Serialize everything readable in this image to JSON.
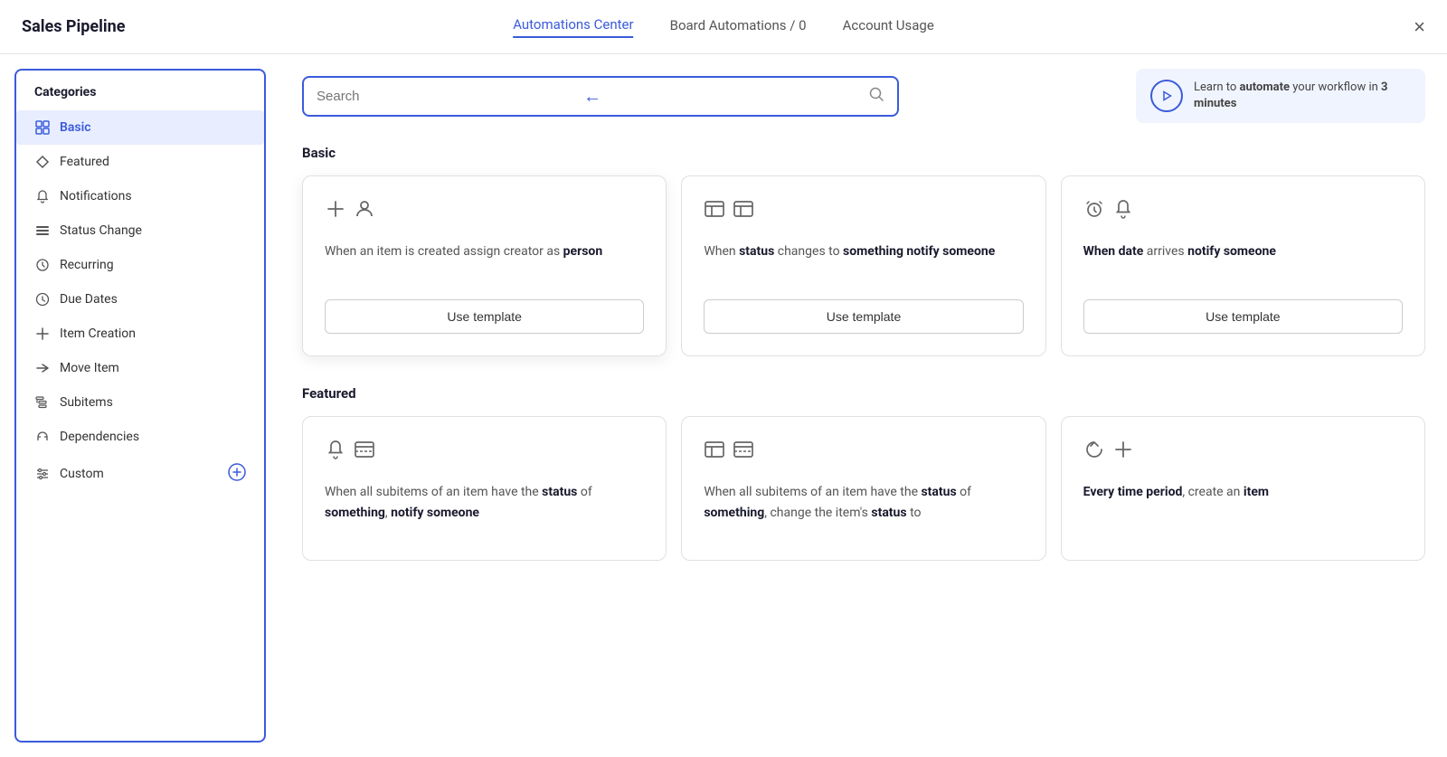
{
  "header": {
    "title": "Sales Pipeline",
    "tabs": [
      {
        "label": "Automations Center",
        "active": true
      },
      {
        "label": "Board Automations / 0",
        "active": false
      },
      {
        "label": "Account Usage",
        "active": false
      }
    ],
    "close_label": "×"
  },
  "sidebar": {
    "title": "Categories",
    "items": [
      {
        "id": "basic",
        "label": "Basic",
        "icon": "grid",
        "active": true
      },
      {
        "id": "featured",
        "label": "Featured",
        "icon": "diamond",
        "active": false
      },
      {
        "id": "notifications",
        "label": "Notifications",
        "icon": "bell",
        "active": false
      },
      {
        "id": "status-change",
        "label": "Status Change",
        "icon": "list",
        "active": false
      },
      {
        "id": "recurring",
        "label": "Recurring",
        "icon": "recurring",
        "active": false
      },
      {
        "id": "due-dates",
        "label": "Due Dates",
        "icon": "clock",
        "active": false
      },
      {
        "id": "item-creation",
        "label": "Item Creation",
        "icon": "plus",
        "active": false
      },
      {
        "id": "move-item",
        "label": "Move Item",
        "icon": "arrow-right",
        "active": false
      },
      {
        "id": "subitems",
        "label": "Subitems",
        "icon": "subitems",
        "active": false
      },
      {
        "id": "dependencies",
        "label": "Dependencies",
        "icon": "dependencies",
        "active": false
      },
      {
        "id": "custom",
        "label": "Custom",
        "icon": "sliders",
        "active": false,
        "has_add": true
      }
    ]
  },
  "search": {
    "placeholder": "Search",
    "has_arrow": true
  },
  "learn_banner": {
    "text_before": "Learn to ",
    "text_bold1": "automate",
    "text_middle": " your workflow in ",
    "text_bold2": "3 minutes"
  },
  "sections": [
    {
      "id": "basic",
      "title": "Basic",
      "cards": [
        {
          "id": "assign-creator",
          "icons": [
            "plus-person"
          ],
          "description": "When an item is created assign creator as ",
          "description_bold": "person",
          "button_label": "Use template",
          "highlighted": true
        },
        {
          "id": "status-notify",
          "icons": [
            "table-table"
          ],
          "description_html": "When <strong>status</strong> changes to <strong>something notify someone</strong>",
          "button_label": "Use template"
        },
        {
          "id": "date-notify",
          "icons": [
            "clock-bell"
          ],
          "description_html": "When <strong>date</strong> arrives <strong>notify someone</strong>",
          "button_label": "Use template"
        }
      ]
    },
    {
      "id": "featured",
      "title": "Featured",
      "cards": [
        {
          "id": "subitem-status-notify",
          "icons": [
            "bell-table"
          ],
          "description_html": "When all subitems of an item have the <strong>status</strong> of <strong>something</strong>, <strong>notify someone</strong>"
        },
        {
          "id": "subitem-status-change",
          "icons": [
            "table-table2"
          ],
          "description_html": "When all subitems of an item have the <strong>status</strong> of <strong>something</strong>, change the item's <strong>status</strong> to"
        },
        {
          "id": "time-period-create",
          "icons": [
            "recurring-plus"
          ],
          "description_html": "<strong>Every time period</strong>, create an <strong>item</strong>"
        }
      ]
    }
  ]
}
